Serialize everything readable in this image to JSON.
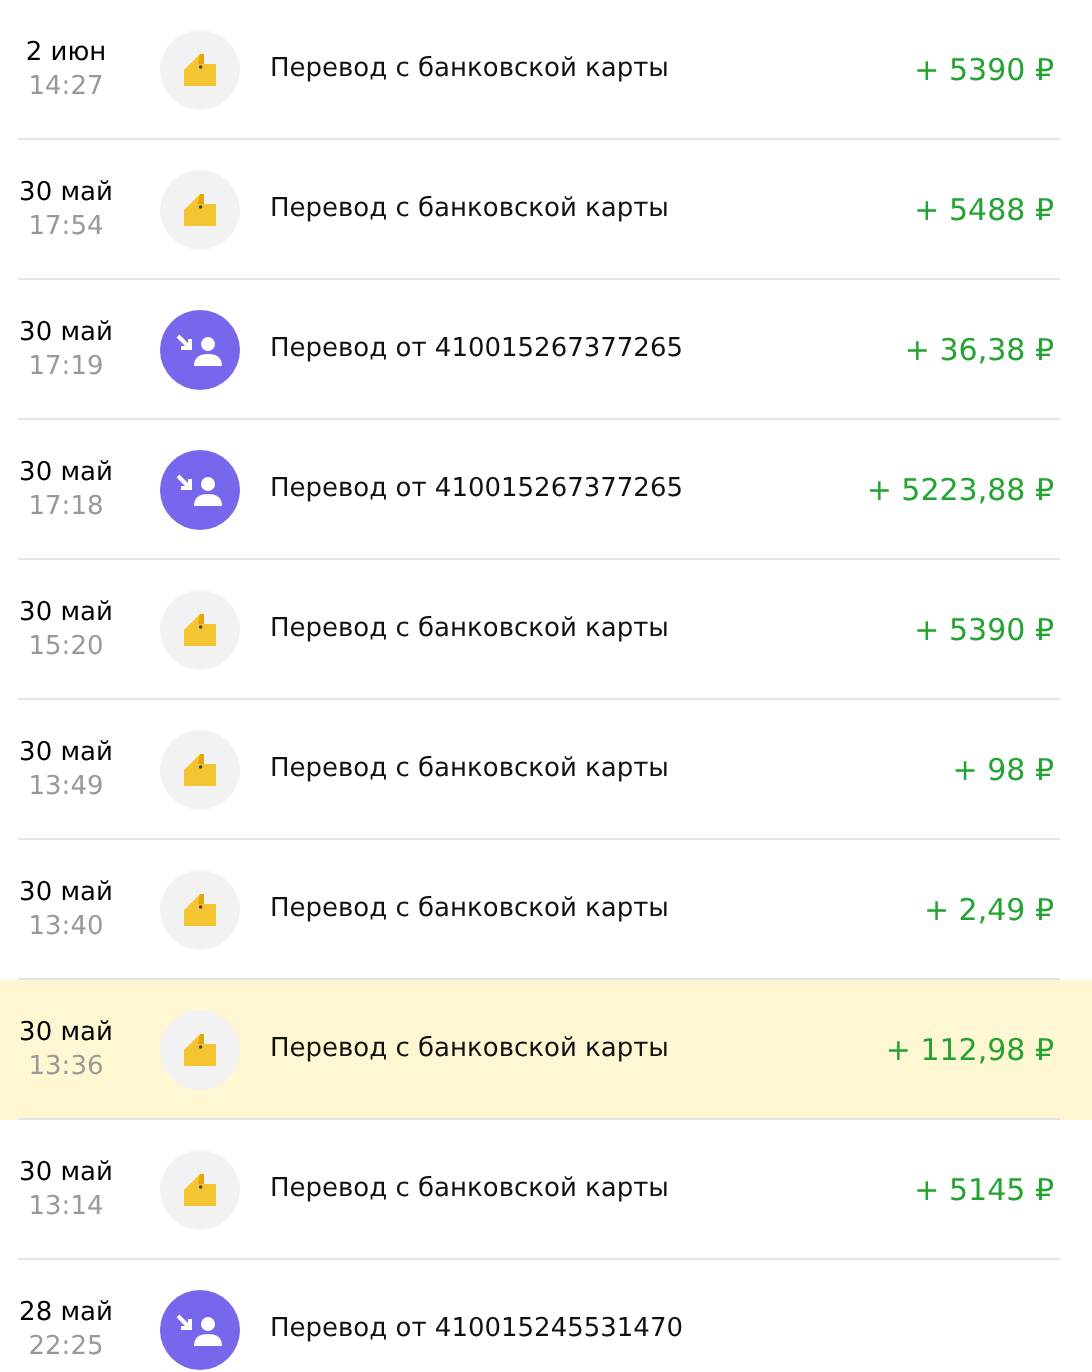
{
  "operations": [
    {
      "date": "2 июн",
      "time": "14:27",
      "kind": "card",
      "title": "Перевод с банковской карты",
      "amount": "+ 5390 ₽",
      "selected": false
    },
    {
      "date": "30 май",
      "time": "17:54",
      "kind": "card",
      "title": "Перевод с банковской карты",
      "amount": "+ 5488 ₽",
      "selected": false
    },
    {
      "date": "30 май",
      "time": "17:19",
      "kind": "person",
      "title": "Перевод от 410015267377265",
      "amount": "+ 36,38 ₽",
      "selected": false
    },
    {
      "date": "30 май",
      "time": "17:18",
      "kind": "person",
      "title": "Перевод от 410015267377265",
      "amount": "+ 5223,88 ₽",
      "selected": false
    },
    {
      "date": "30 май",
      "time": "15:20",
      "kind": "card",
      "title": "Перевод с банковской карты",
      "amount": "+ 5390 ₽",
      "selected": false
    },
    {
      "date": "30 май",
      "time": "13:49",
      "kind": "card",
      "title": "Перевод с банковской карты",
      "amount": "+ 98 ₽",
      "selected": false
    },
    {
      "date": "30 май",
      "time": "13:40",
      "kind": "card",
      "title": "Перевод с банковской карты",
      "amount": "+ 2,49 ₽",
      "selected": false
    },
    {
      "date": "30 май",
      "time": "13:36",
      "kind": "card",
      "title": "Перевод с банковской карты",
      "amount": "+ 112,98 ₽",
      "selected": true
    },
    {
      "date": "30 май",
      "time": "13:14",
      "kind": "card",
      "title": "Перевод с банковской карты",
      "amount": "+ 5145 ₽",
      "selected": false
    },
    {
      "date": "28 май",
      "time": "22:25",
      "kind": "person",
      "title": "Перевод от 410015245531470",
      "selected": false
    }
  ]
}
